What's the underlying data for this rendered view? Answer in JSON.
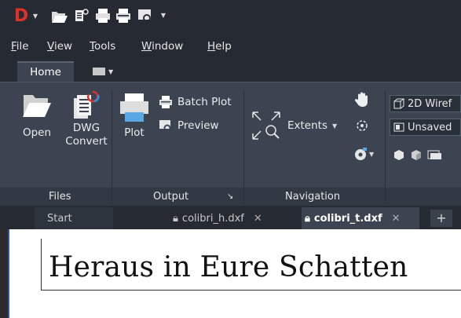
{
  "quick_access": {
    "logo_letter": "D",
    "items": [
      "app-menu-caret",
      "open-icon",
      "dwg-convert-icon",
      "plot-icon",
      "batch-plot-icon",
      "preview-icon",
      "customize-caret"
    ]
  },
  "menu": {
    "items": [
      {
        "label": "File",
        "underline": "F"
      },
      {
        "label": "View",
        "underline": "V"
      },
      {
        "label": "Tools",
        "underline": "T"
      },
      {
        "label": "Window",
        "underline": "W"
      },
      {
        "label": "Help",
        "underline": "H"
      }
    ]
  },
  "ribbon_tabs": {
    "home": "Home"
  },
  "ribbon": {
    "files": {
      "title": "Files",
      "open": "Open",
      "dwg_convert_line1": "DWG",
      "dwg_convert_line2": "Convert"
    },
    "output": {
      "title": "Output",
      "plot": "Plot",
      "batch_plot": "Batch Plot",
      "preview": "Preview"
    },
    "navigation": {
      "title": "Navigation",
      "extents": "Extents"
    },
    "view": {
      "visual_style": "2D Wiref",
      "named_view": "Unsaved"
    }
  },
  "doc_tabs": {
    "start": "Start",
    "tab1": "colibri_h.dxf",
    "tab2": "colibri_t.dxf",
    "close_glyph": "✕",
    "plus": "+"
  },
  "canvas": {
    "text": "Heraus in Eure Schatten"
  },
  "colors": {
    "app_red": "#e0302a",
    "ribbon_bg": "#3c4452",
    "titlebar_bg": "#262b33",
    "canvas_bg": "#ffffff"
  }
}
